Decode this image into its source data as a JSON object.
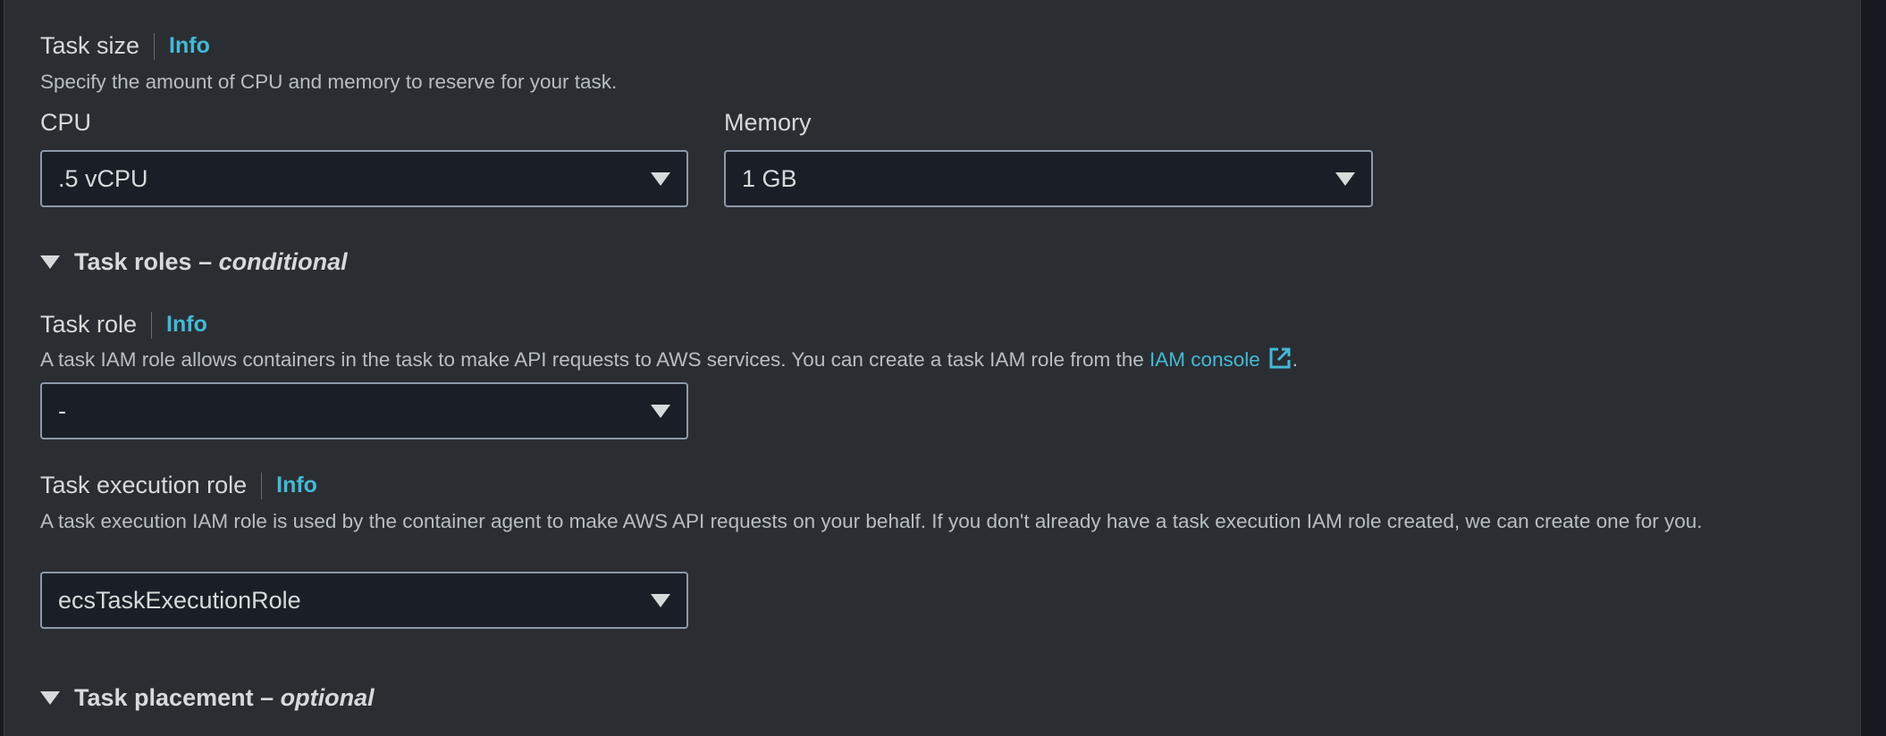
{
  "task_size": {
    "title": "Task size",
    "info": "Info",
    "description": "Specify the amount of CPU and memory to reserve for your task.",
    "cpu": {
      "label": "CPU",
      "value": ".5 vCPU"
    },
    "memory": {
      "label": "Memory",
      "value": "1 GB"
    }
  },
  "task_roles": {
    "title": "Task roles",
    "separator": " – ",
    "tag": "conditional",
    "task_role": {
      "title": "Task role",
      "info": "Info",
      "description_prefix": "A task IAM role allows containers in the task to make API requests to AWS services. You can create a task IAM role from the ",
      "link_text": "IAM console",
      "description_suffix": ".",
      "value": "-"
    },
    "task_execution_role": {
      "title": "Task execution role",
      "info": "Info",
      "description": "A task execution IAM role is used by the container agent to make AWS API requests on your behalf. If you don't already have a task execution IAM role created, we can create one for you.",
      "value": "ecsTaskExecutionRole"
    }
  },
  "task_placement": {
    "title": "Task placement",
    "separator": " – ",
    "tag": "optional"
  },
  "icons": {
    "caret": "caret-down-icon",
    "expand": "expand-triangle-icon",
    "external": "external-link-icon"
  },
  "colors": {
    "panel_bg": "#2a2e33",
    "input_bg": "#1a1f27",
    "link": "#44b9d6",
    "text": "#d5dbdb"
  }
}
